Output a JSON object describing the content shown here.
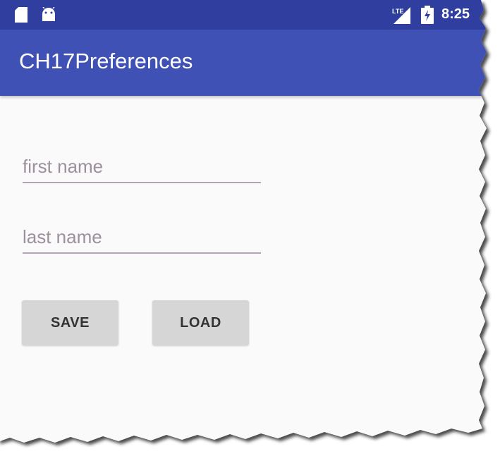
{
  "status_bar": {
    "time": "8:25",
    "icons": [
      "sd-card-icon",
      "android-icon",
      "lte-signal-icon",
      "battery-charging-icon"
    ],
    "lte_label": "LTE",
    "color": "#303f9f"
  },
  "app_bar": {
    "title": "CH17Preferences",
    "color": "#3f51b5"
  },
  "form": {
    "first_name": {
      "value": "",
      "placeholder": "first name"
    },
    "last_name": {
      "value": "",
      "placeholder": "last name"
    }
  },
  "buttons": {
    "save_label": "SAVE",
    "load_label": "LOAD"
  }
}
